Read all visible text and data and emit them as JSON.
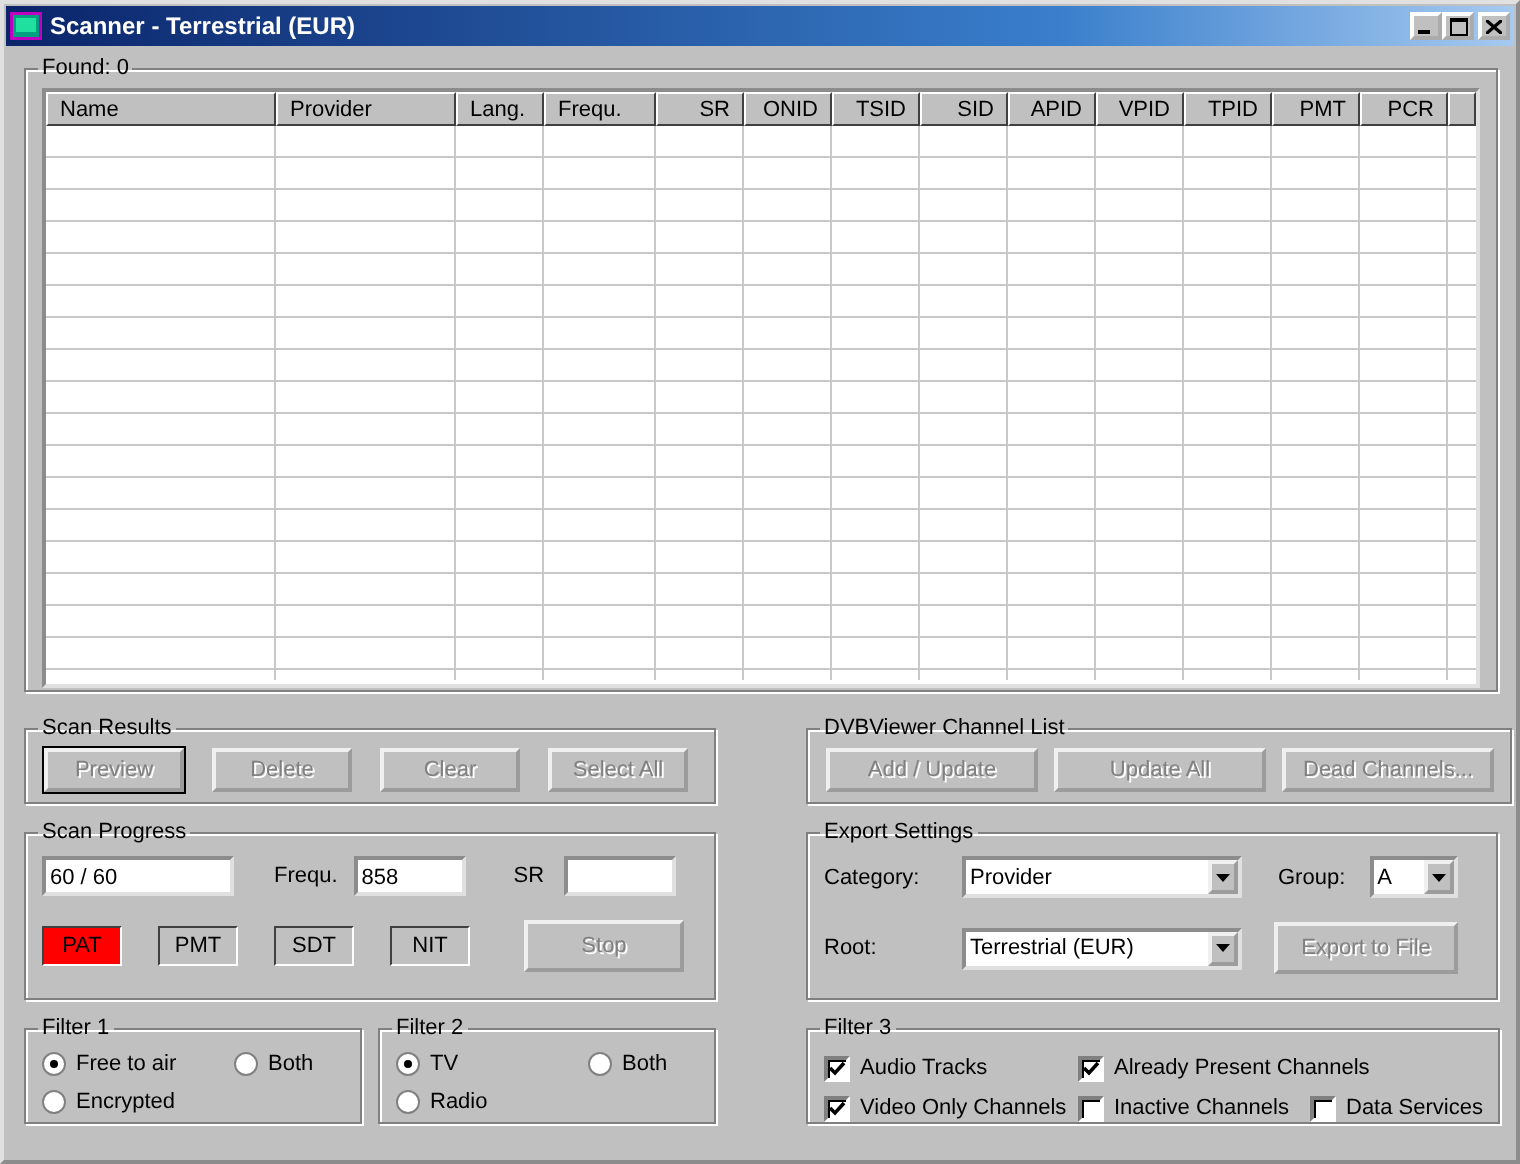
{
  "window": {
    "title": "Scanner - Terrestrial (EUR)"
  },
  "found": {
    "label": "Found:",
    "count": "0"
  },
  "table": {
    "columns": [
      "Name",
      "Provider",
      "Lang.",
      "Frequ.",
      "SR",
      "ONID",
      "TSID",
      "SID",
      "APID",
      "VPID",
      "TPID",
      "PMT",
      "PCR"
    ]
  },
  "scan_results": {
    "title": "Scan Results",
    "buttons": [
      {
        "label": "Preview",
        "disabled": true,
        "default": true
      },
      {
        "label": "Delete",
        "disabled": true,
        "default": false
      },
      {
        "label": "Clear",
        "disabled": true,
        "default": false
      },
      {
        "label": "Select All",
        "disabled": true,
        "default": false
      }
    ]
  },
  "scan_progress": {
    "title": "Scan Progress",
    "counter": "60 / 60",
    "frequ_label": "Frequ.",
    "frequ_value": "858",
    "sr_label": "SR",
    "tables": [
      {
        "label": "PAT",
        "active": true
      },
      {
        "label": "PMT",
        "active": false
      },
      {
        "label": "SDT",
        "active": false
      },
      {
        "label": "NIT",
        "active": false
      }
    ],
    "stop": {
      "label": "Stop",
      "disabled": true
    }
  },
  "filter_1": {
    "title": "Filter 1",
    "options": [
      {
        "label": "Free to air",
        "selected": true
      },
      {
        "label": "Both",
        "selected": false
      },
      {
        "label": "Encrypted",
        "selected": false
      }
    ]
  },
  "filter_2": {
    "title": "Filter 2",
    "options": [
      {
        "label": "TV",
        "selected": true
      },
      {
        "label": "Both",
        "selected": false
      },
      {
        "label": "Radio",
        "selected": false
      }
    ]
  },
  "channel_list": {
    "title": "DVBViewer Channel List",
    "buttons": [
      {
        "label": "Add / Update",
        "disabled": true
      },
      {
        "label": "Update All",
        "disabled": true
      },
      {
        "label": "Dead Channels...",
        "disabled": true
      }
    ]
  },
  "export": {
    "title": "Export Settings",
    "category_label": "Category:",
    "category_value": "Provider",
    "group_label": "Group:",
    "group_value": "A",
    "root_label": "Root:",
    "root_value": "Terrestrial (EUR)",
    "button": {
      "label": "Export to File",
      "disabled": true
    }
  },
  "filter_3": {
    "title": "Filter 3",
    "rows": [
      [
        {
          "label": "Audio Tracks",
          "checked": true
        },
        {
          "label": "Already Present Channels",
          "checked": true
        }
      ],
      [
        {
          "label": "Video Only Channels",
          "checked": true
        },
        {
          "label": "Inactive Channels",
          "checked": false
        },
        {
          "label": "Data Services",
          "checked": false
        }
      ]
    ]
  }
}
